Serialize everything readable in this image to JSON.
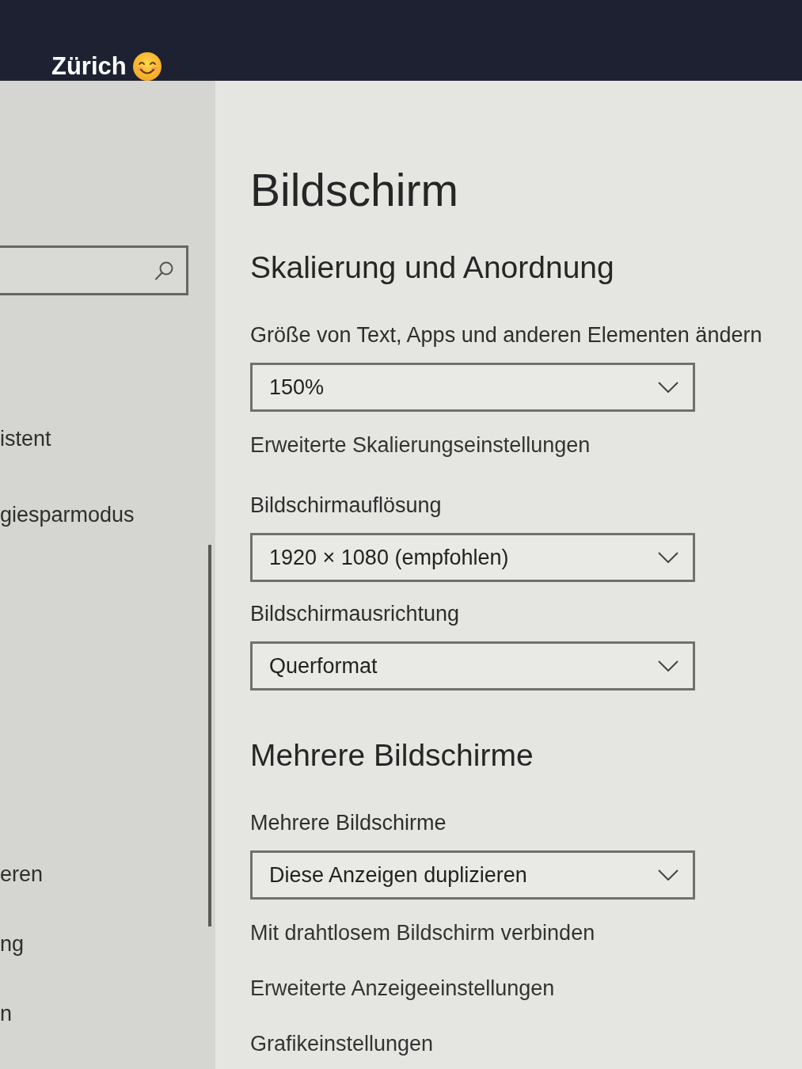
{
  "caption": {
    "text": "Zürich"
  },
  "sidebar": {
    "groups": [
      {
        "items": [
          "istent",
          "giesparmodus"
        ]
      },
      {
        "items": [
          "eren",
          "ng",
          "n"
        ]
      }
    ]
  },
  "page": {
    "title": "Bildschirm",
    "sections": [
      {
        "heading": "Skalierung und Anordnung",
        "settings": [
          {
            "kind": "dropdown",
            "label": "Größe von Text, Apps und anderen Elementen ändern",
            "value": "150%"
          },
          {
            "kind": "link",
            "text": "Erweiterte Skalierungseinstellungen"
          },
          {
            "kind": "dropdown",
            "label": "Bildschirmauflösung",
            "value": "1920 × 1080 (empfohlen)"
          },
          {
            "kind": "dropdown",
            "label": "Bildschirmausrichtung",
            "value": "Querformat"
          }
        ]
      },
      {
        "heading": "Mehrere Bildschirme",
        "settings": [
          {
            "kind": "dropdown",
            "label": "Mehrere Bildschirme",
            "value": "Diese Anzeigen duplizieren"
          },
          {
            "kind": "link",
            "text": "Mit drahtlosem Bildschirm verbinden"
          },
          {
            "kind": "link",
            "text": "Erweiterte Anzeigeeinstellungen"
          },
          {
            "kind": "link",
            "text": "Grafikeinstellungen"
          }
        ]
      }
    ]
  }
}
